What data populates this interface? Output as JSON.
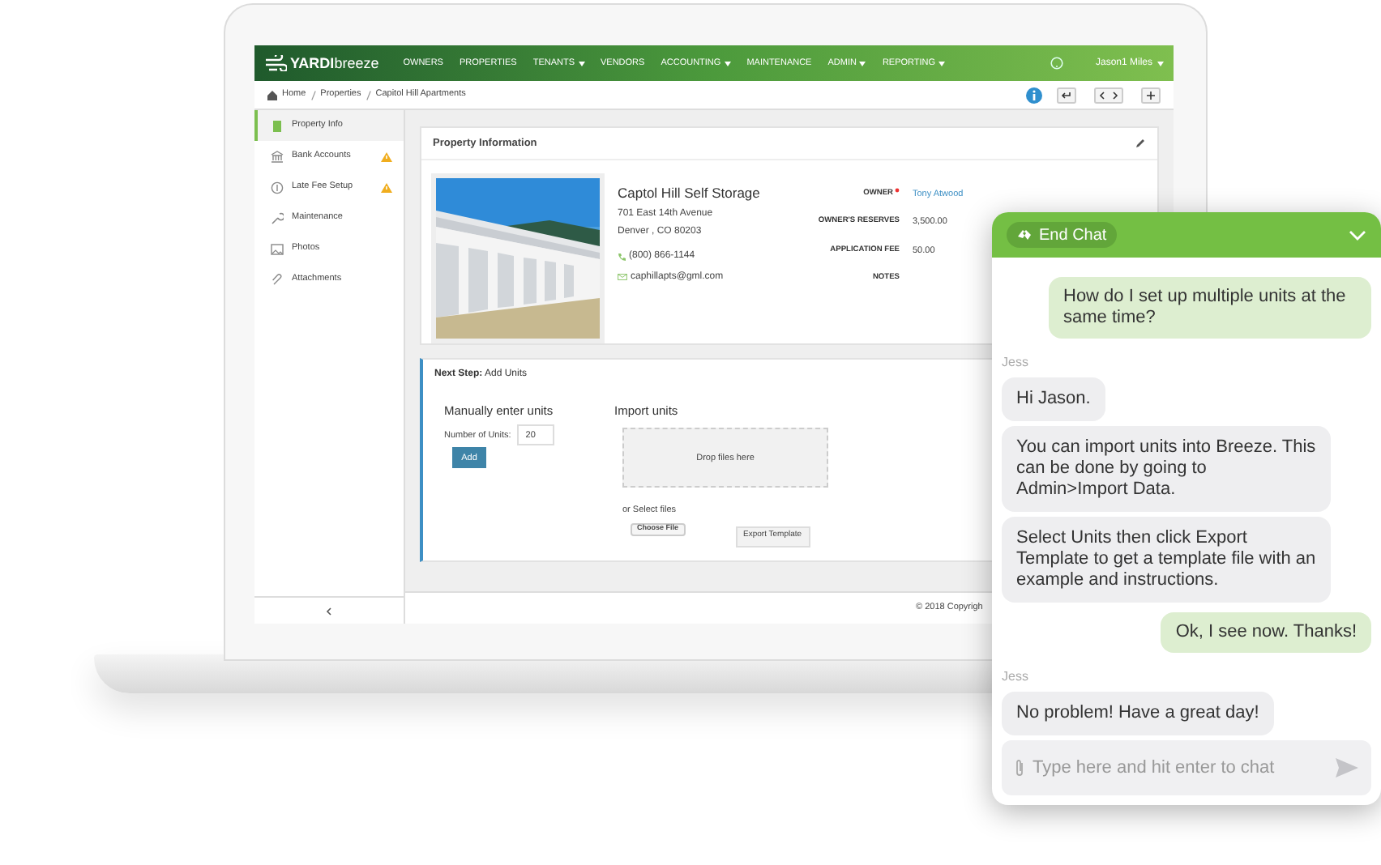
{
  "app": {
    "logo": {
      "brand": "YARDI",
      "product": "breeze"
    },
    "nav": [
      {
        "label": "OWNERS",
        "dropdown": false
      },
      {
        "label": "PROPERTIES",
        "dropdown": false
      },
      {
        "label": "TENANTS",
        "dropdown": true
      },
      {
        "label": "VENDORS",
        "dropdown": false
      },
      {
        "label": "ACCOUNTING",
        "dropdown": true
      },
      {
        "label": "MAINTENANCE",
        "dropdown": false
      },
      {
        "label": "ADMIN",
        "dropdown": true
      },
      {
        "label": "REPORTING",
        "dropdown": true
      }
    ],
    "user": "Jason1 Miles",
    "breadcrumb": [
      "Home",
      "Properties",
      "Capitol Hill Apartments"
    ],
    "sidebar": [
      {
        "label": "Property Info",
        "selected": true,
        "warning": false
      },
      {
        "label": "Bank Accounts",
        "selected": false,
        "warning": true
      },
      {
        "label": "Late Fee Setup",
        "selected": false,
        "warning": true
      },
      {
        "label": "Maintenance",
        "selected": false,
        "warning": false
      },
      {
        "label": "Photos",
        "selected": false,
        "warning": false
      },
      {
        "label": "Attachments",
        "selected": false,
        "warning": false
      }
    ],
    "property": {
      "title": "Property Information",
      "name": "Captol Hill Self Storage",
      "address": [
        "701 East 14th Avenue",
        "Denver , CO 80203"
      ],
      "phone": "(800) 866-1144",
      "email": "caphillapts@gml.com",
      "fields": [
        {
          "label": "OWNER",
          "value": "Tony Atwood",
          "required": true,
          "link": true
        },
        {
          "label": "OWNER'S RESERVES",
          "value": "3,500.00",
          "required": false,
          "link": false
        },
        {
          "label": "APPLICATION FEE",
          "value": "50.00",
          "required": false,
          "link": false
        },
        {
          "label": "NOTES",
          "required": false
        }
      ]
    },
    "next_step": "**Next Step:** Add Units",
    "manual": {
      "heading": "Manually enter units",
      "field_label": "Number of Units:",
      "value": "20",
      "button": "Add"
    },
    "import": {
      "heading": "Import units",
      "drop": "Drop files here",
      "or_select": "or Select files",
      "choose": "Choose File",
      "export": "Export Template"
    },
    "footer": "© 2018 Copyrigh"
  },
  "chat": {
    "end_button": "End Chat",
    "messages": [
      {
        "kind": "user",
        "text": "How do I set up multiple units at the same time?"
      },
      {
        "kind": "author",
        "text": "Jess"
      },
      {
        "kind": "agent",
        "text": "Hi Jason."
      },
      {
        "kind": "agent",
        "text": "You can import units into Breeze. This can be done by going to Admin>Import Data."
      },
      {
        "kind": "agent",
        "text": "Select Units then click Export Template to get a template file with an example and instructions."
      },
      {
        "kind": "user",
        "text": "Ok, I see now. Thanks!"
      },
      {
        "kind": "author",
        "text": "Jess"
      },
      {
        "kind": "agent",
        "text": "No problem! Have a great day!"
      }
    ],
    "placeholder": "Type here and hit enter to chat"
  }
}
